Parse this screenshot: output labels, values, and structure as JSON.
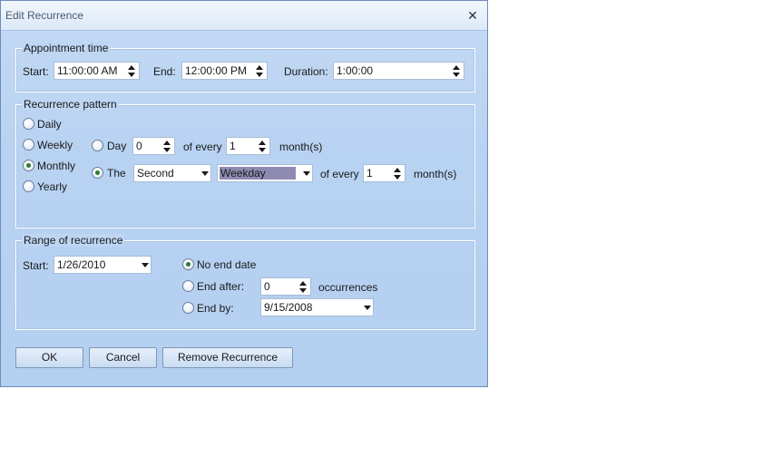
{
  "window": {
    "title": "Edit Recurrence",
    "close_glyph": "✕"
  },
  "appointment_time": {
    "legend": "Appointment time",
    "start_label": "Start:",
    "start_value": "11:00:00 AM",
    "end_label": "End:",
    "end_value": "12:00:00 PM",
    "duration_label": "Duration:",
    "duration_value": "1:00:00"
  },
  "recurrence_pattern": {
    "legend": "Recurrence pattern",
    "types": [
      {
        "label": "Daily",
        "checked": false
      },
      {
        "label": "Weekly",
        "checked": false
      },
      {
        "label": "Monthly",
        "checked": true
      },
      {
        "label": "Yearly",
        "checked": false
      }
    ],
    "day_option": {
      "label": "Day",
      "checked": false,
      "day_value": "0",
      "of_every_label": "of every",
      "months_value": "1",
      "months_label": "month(s)"
    },
    "the_option": {
      "label": "The",
      "checked": true,
      "ordinal_value": "Second",
      "weekday_value": "Weekday",
      "of_every_label": "of every",
      "months_value": "1",
      "months_label": "month(s)"
    }
  },
  "range_of_recurrence": {
    "legend": "Range of recurrence",
    "start_label": "Start:",
    "start_value": "1/26/2010",
    "no_end_date_label": "No end date",
    "end_after_label": "End after:",
    "end_after_value": "0",
    "occurrences_label": "occurrences",
    "end_by_label": "End by:",
    "end_by_value": "9/15/2008",
    "selected": "no_end_date"
  },
  "buttons": {
    "ok": "OK",
    "cancel": "Cancel",
    "remove": "Remove Recurrence"
  }
}
